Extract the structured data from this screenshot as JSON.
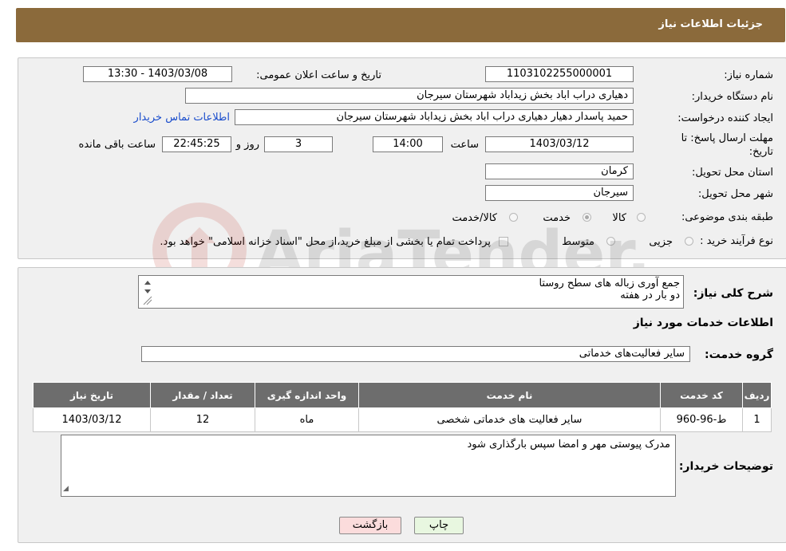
{
  "header": {
    "title": "جزئیات اطلاعات نیاز"
  },
  "details": {
    "need_number_label": "شماره نیاز:",
    "need_number": "1103102255000001",
    "announce_datetime_label": "تاریخ و ساعت اعلان عمومی:",
    "announce_datetime": "1403/03/08 - 13:30",
    "buyer_org_label": "نام دستگاه خریدار:",
    "buyer_org": "دهیاری دراب اباد بخش زیداباد شهرستان سیرجان",
    "requester_label": "ایجاد کننده درخواست:",
    "requester": "حمید پاسدار دهیار دهیاری دراب اباد بخش زیداباد شهرستان سیرجان",
    "contact_link": "اطلاعات تماس خریدار",
    "deadline_label_line1": "مهلت ارسال پاسخ: تا",
    "deadline_label_line2": "تاریخ:",
    "deadline_date": "1403/03/12",
    "time_label": "ساعت",
    "deadline_time": "14:00",
    "days_value": "3",
    "days_label": "روز و",
    "remaining_time": "22:45:25",
    "remaining_label": "ساعت باقی مانده",
    "province_label": "استان محل تحویل:",
    "province": "کرمان",
    "city_label": "شهر محل تحویل:",
    "city": "سیرجان",
    "category_label": "طبقه بندی موضوعی:",
    "category_options": [
      {
        "label": "کالا",
        "selected": false
      },
      {
        "label": "خدمت",
        "selected": true
      },
      {
        "label": "کالا/خدمت",
        "selected": false
      }
    ],
    "purchase_type_label": "نوع فرآیند خرید :",
    "purchase_type_options": [
      {
        "label": "جزیی",
        "selected": false
      },
      {
        "label": "متوسط",
        "selected": false
      }
    ],
    "payment_note": "پرداخت تمام یا بخشی از مبلغ خرید،از محل \"اسناد خزانه اسلامی\" خواهد بود."
  },
  "watermark": {
    "text": "AriaTender.net"
  },
  "services": {
    "description_label": "شرح کلی نیاز:",
    "description_lines": [
      "جمع آوری زباله های سطح روستا",
      "دو بار در هفته"
    ],
    "section_title": "اطلاعات خدمات مورد نیاز",
    "service_group_label": "گروه خدمت:",
    "service_group": "سایر فعالیت‌های خدماتی",
    "table": {
      "columns": [
        "ردیف",
        "کد خدمت",
        "نام خدمت",
        "واحد اندازه گیری",
        "تعداد / مقدار",
        "تاریخ نیاز"
      ],
      "rows": [
        [
          "1",
          "ط-96-960",
          "سایر فعالیت های خدماتی شخصی",
          "ماه",
          "12",
          "1403/03/12"
        ]
      ]
    },
    "buyer_notes_label": "توضیحات خریدار:",
    "buyer_notes": "مدرک پیوستی مهر و امضا سپس بارگذاری شود"
  },
  "buttons": {
    "print": "چاپ",
    "back": "بازگشت"
  }
}
